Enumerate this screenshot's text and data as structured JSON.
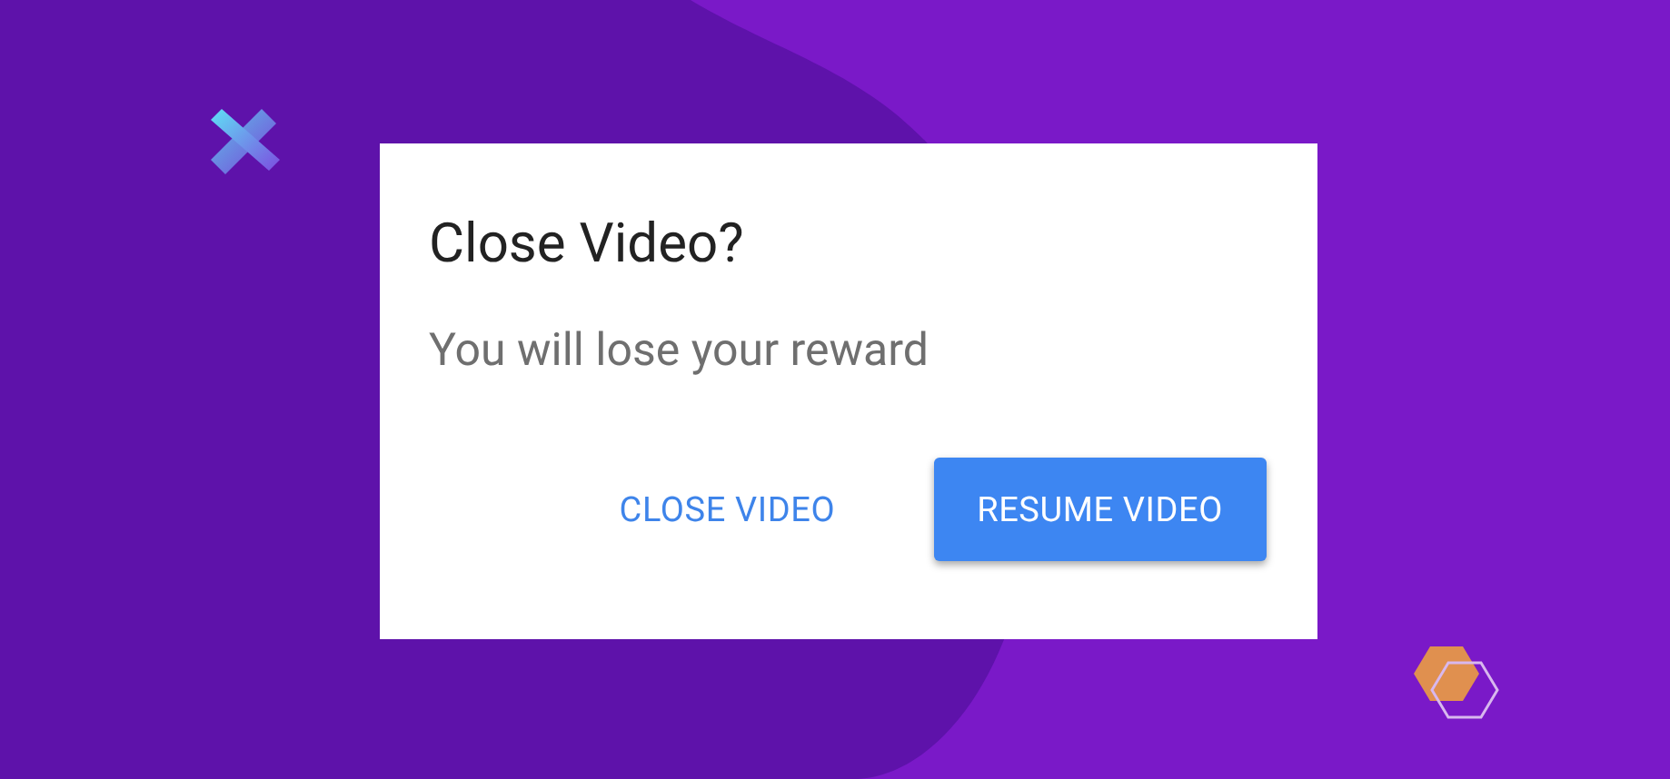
{
  "dialog": {
    "title": "Close Video?",
    "message": "You will lose your reward",
    "buttons": [
      {
        "label": "CLOSE VIDEO",
        "kind": "text"
      },
      {
        "label": "RESUME VIDEO",
        "kind": "contained"
      }
    ]
  }
}
